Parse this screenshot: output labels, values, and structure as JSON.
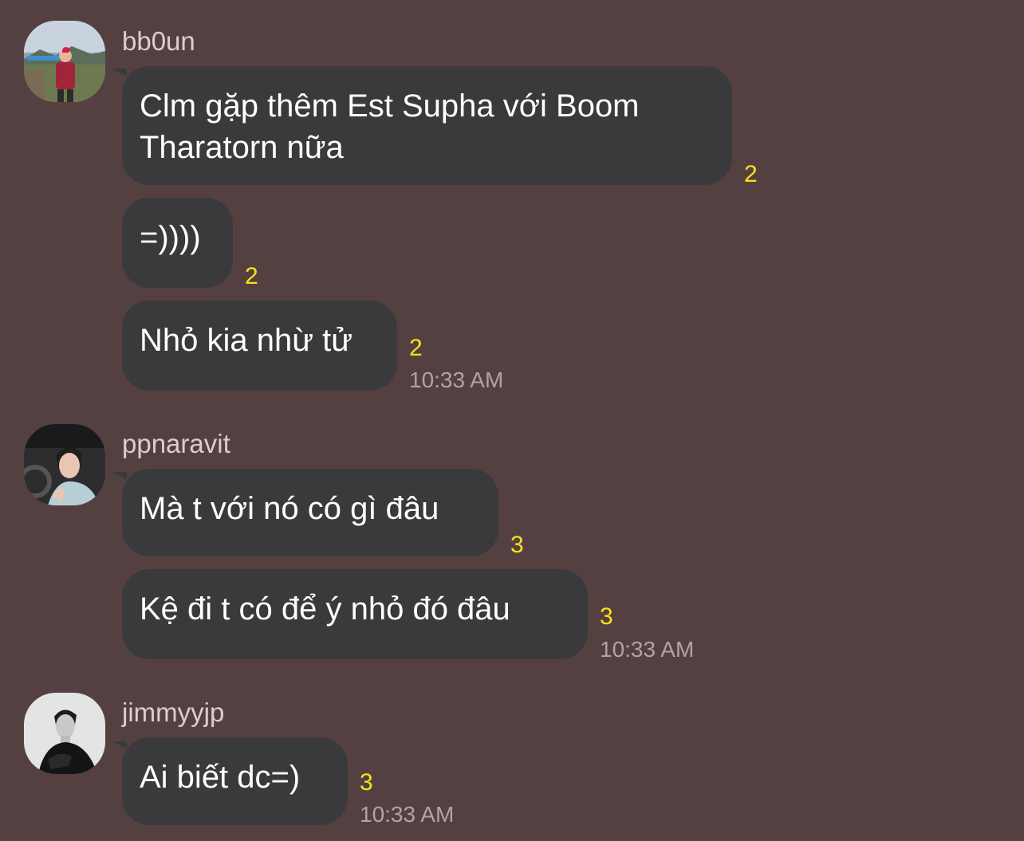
{
  "groups": [
    {
      "sender": "bb0un",
      "avatar_icon": "profile-photo-icon",
      "messages": [
        {
          "text": "Clm gặp thêm Est Supha với Boom\nTharatorn nữa",
          "read_count": "2"
        },
        {
          "text": "=))))",
          "read_count": "2"
        },
        {
          "text": "Nhỏ kia nhừ tử",
          "read_count": "2",
          "time": "10:33 AM"
        }
      ]
    },
    {
      "sender": "ppnaravit",
      "avatar_icon": "profile-photo-icon",
      "messages": [
        {
          "text": "Mà t với nó có gì đâu",
          "read_count": "3"
        },
        {
          "text": "Kệ đi t có để ý nhỏ đó đâu",
          "read_count": "3",
          "time": "10:33 AM"
        }
      ]
    },
    {
      "sender": "jimmyyjp",
      "avatar_icon": "profile-photo-icon",
      "messages": [
        {
          "text": "Ai biết dc=)",
          "read_count": "3",
          "time": "10:33 AM"
        }
      ]
    }
  ],
  "colors": {
    "background": "#554041",
    "bubble": "#3a3a3c",
    "read_count": "#f7e21b",
    "timestamp": "#b0a3a4"
  }
}
